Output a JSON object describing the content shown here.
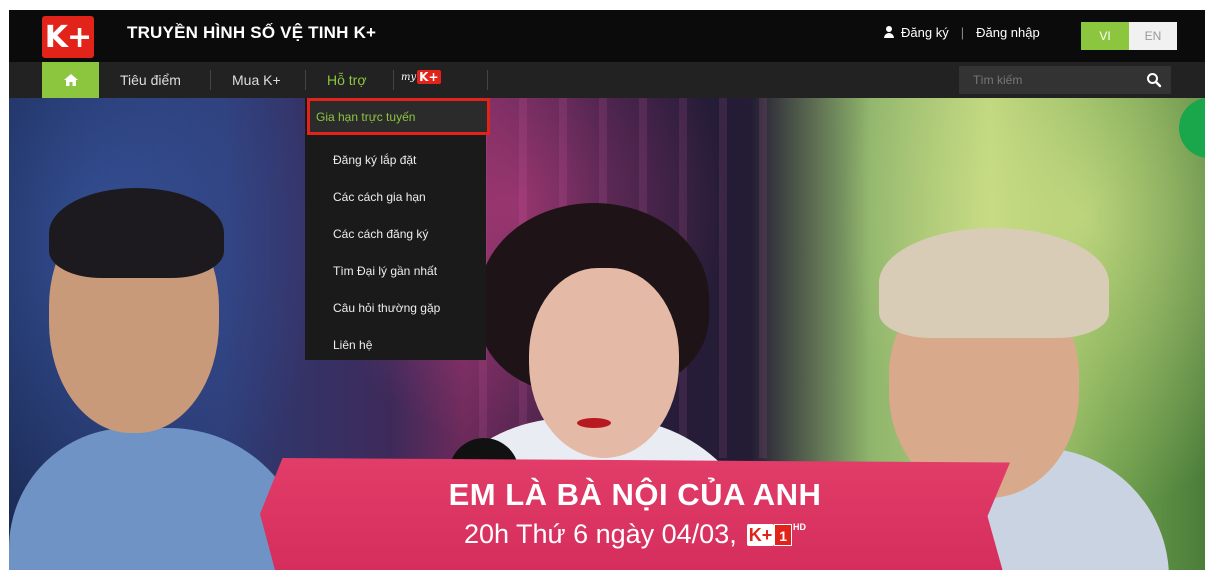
{
  "header": {
    "logo_text": "K+",
    "title": "TRUYỀN HÌNH SỐ VỆ TINH K+",
    "register_label": "Đăng ký",
    "separator": "|",
    "login_label": "Đăng nhập",
    "lang_vi": "VI",
    "lang_en": "EN",
    "active_lang": "VI"
  },
  "nav": {
    "home_icon": "home-icon",
    "items": [
      {
        "label": "Tiêu điểm"
      },
      {
        "label": "Mua K+"
      },
      {
        "label": "Hỗ trợ"
      }
    ],
    "active_item": "Hỗ trợ",
    "mykplus_my": "my",
    "mykplus_k": "K+",
    "search_placeholder": "Tìm kiếm",
    "accent_color": "#8cc63f"
  },
  "dropdown": {
    "items": [
      {
        "label": "Gia hạn trực tuyến"
      },
      {
        "label": "Đăng ký lắp đặt"
      },
      {
        "label": "Các cách gia hạn"
      },
      {
        "label": "Các cách đăng ký"
      },
      {
        "label": "Tìm Đại lý gần nhất"
      },
      {
        "label": "Câu hỏi thường gặp"
      },
      {
        "label": "Liên hệ"
      }
    ],
    "highlighted_item": "Gia hạn trực tuyến",
    "highlight_color": "#e2231a"
  },
  "hero": {
    "title": "EM LÀ BÀ NỘI CỦA ANH",
    "subtitle": "20h Thứ 6 ngày 04/03,",
    "channel_k": "K+",
    "channel_num": "1",
    "channel_hd": "HD",
    "banner_color": "#e23c69"
  }
}
